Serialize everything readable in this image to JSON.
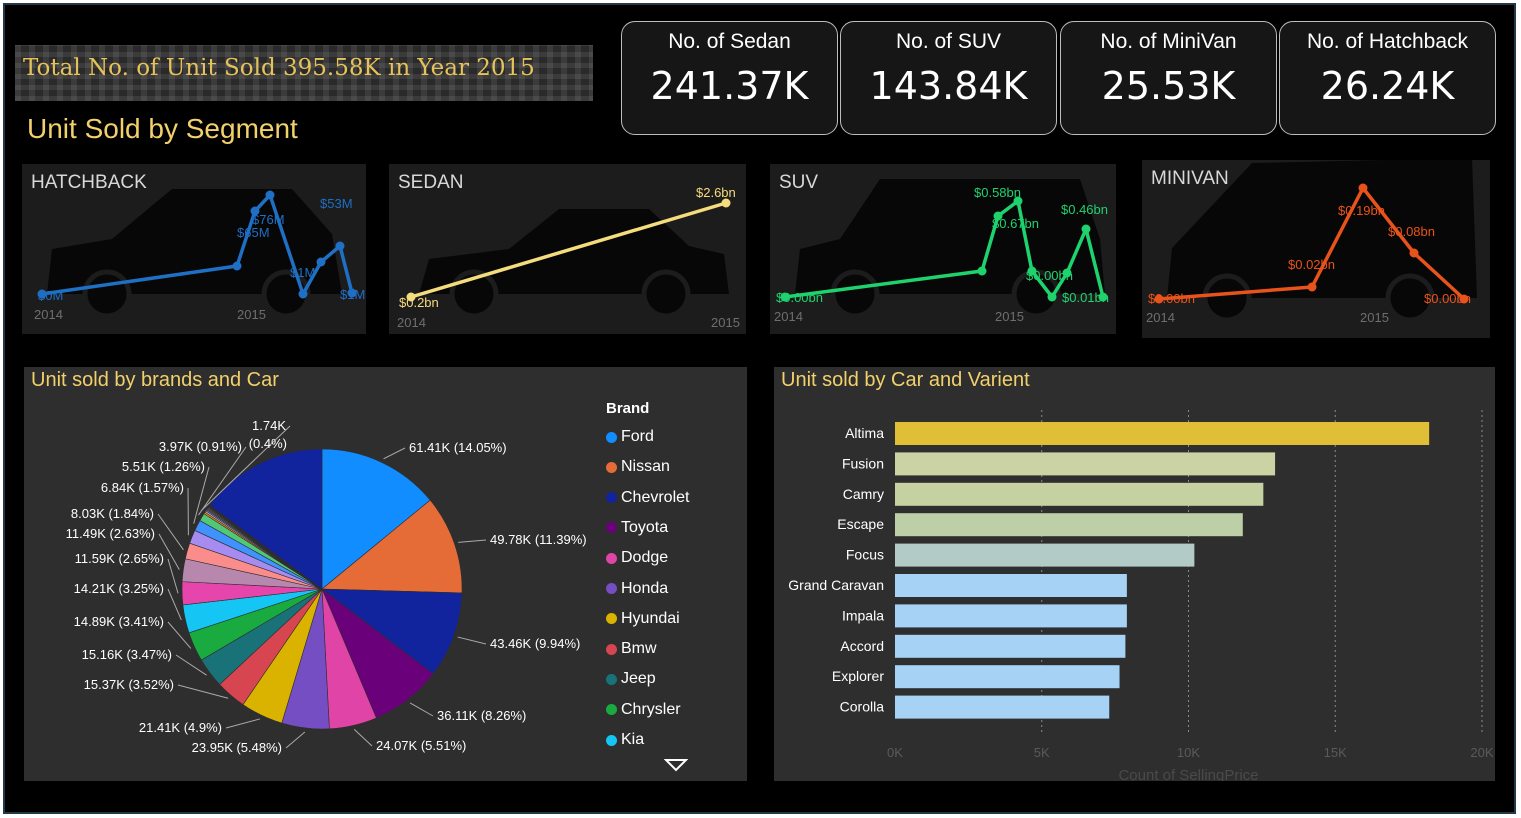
{
  "header": {
    "headline": "Total No. of Unit Sold 395.58K in Year 2015",
    "segment_title": "Unit Sold by Segment"
  },
  "kpis": [
    {
      "label": "No. of Sedan",
      "value": "241.37K"
    },
    {
      "label": "No. of SUV",
      "value": "143.84K"
    },
    {
      "label": "No. of MiniVan",
      "value": "25.53K"
    },
    {
      "label": "No. of Hatchback",
      "value": "26.24K"
    }
  ],
  "colors": {
    "hatchback": "#1f6fc4",
    "sedan": "#f5dc7d",
    "suv": "#1ed36e",
    "minivan": "#e8531c",
    "title": "#f2d16b"
  },
  "segments": [
    {
      "name": "HATCHBACK",
      "x_labels": [
        "2014",
        "2015"
      ],
      "labels": [
        "$0M",
        "$65M",
        "$76M",
        "$1M",
        "$53M",
        "$1M"
      ]
    },
    {
      "name": "SEDAN",
      "x_labels": [
        "2014",
        "2015"
      ],
      "labels": [
        "$0.2bn",
        "$2.6bn"
      ]
    },
    {
      "name": "SUV",
      "x_labels": [
        "2014",
        "2015"
      ],
      "labels": [
        "$0.00bn",
        "$0.58bn",
        "$0.67bn",
        "$0.00bn",
        "$0.46bn",
        "$0.01bn"
      ]
    },
    {
      "name": "MINIVAN",
      "x_labels": [
        "2014",
        "2015"
      ],
      "labels": [
        "$0.00bn",
        "$0.02bn",
        "$0.19bn",
        "$0.08bn",
        "$0.00bn"
      ]
    }
  ],
  "chart_data": [
    {
      "type": "pie",
      "title": "Unit sold by brands and Car",
      "legend_title": "Brand",
      "legend": [
        "Ford",
        "Nissan",
        "Chevrolet",
        "Toyota",
        "Dodge",
        "Honda",
        "Hyundai",
        "Bmw",
        "Jeep",
        "Chrysler",
        "Kia"
      ],
      "values": [
        61.41,
        49.78,
        43.46,
        36.11,
        24.07,
        23.95,
        21.41,
        15.37,
        15.16,
        14.89,
        14.21,
        11.59,
        11.49,
        8.03,
        6.84,
        5.51,
        3.97,
        1.74
      ],
      "labels": [
        "61.41K (14.05%)",
        "49.78K (11.39%)",
        "43.46K (9.94%)",
        "36.11K (8.26%)",
        "24.07K (5.51%)",
        "23.95K (5.48%)",
        "21.41K (4.9%)",
        "15.37K (3.52%)",
        "15.16K (3.47%)",
        "14.89K (3.41%)",
        "14.21K (3.25%)",
        "11.59K (2.65%)",
        "11.49K (2.63%)",
        "8.03K (1.84%)",
        "6.84K (1.57%)",
        "5.51K (1.26%)",
        "3.97K (0.91%)",
        "1.74K"
      ],
      "extra_label": "(0.4%)",
      "colors": [
        "#118dff",
        "#e66c37",
        "#12239e",
        "#6b007b",
        "#e044a7",
        "#744ec2",
        "#d9b300",
        "#d64550",
        "#197278",
        "#1aab40",
        "#15c6f4",
        "#e645ab",
        "#b887ad",
        "#fa8c8c",
        "#a68cf1",
        "#4092ff",
        "#50c878",
        "#ff7f0e",
        "#c0c0c0",
        "#7b68ee",
        "#2e8b57",
        "#ff6347",
        "#ba55d3",
        "#20b2aa",
        "#daa520"
      ],
      "small_slices": [
        0.9,
        0.8,
        0.7,
        0.6,
        0.5,
        0.4,
        0.35,
        0.3,
        0.3,
        0.25
      ]
    },
    {
      "type": "bar",
      "title": "Unit sold by Car and Varient",
      "categories": [
        "Altima",
        "Fusion",
        "Camry",
        "Escape",
        "Focus",
        "Grand Caravan",
        "Impala",
        "Accord",
        "Explorer",
        "Corolla"
      ],
      "values": [
        18200,
        12950,
        12550,
        11850,
        10200,
        7900,
        7900,
        7850,
        7650,
        7300
      ],
      "colors": [
        "#e0bf36",
        "#cbd2a4",
        "#c6d1a2",
        "#bccfa7",
        "#b3cbc6",
        "#a6d2f5",
        "#a6d2f5",
        "#a6d2f5",
        "#a6d2f5",
        "#a6d2f5"
      ],
      "xlabel": "Count of SellingPrice",
      "xlim": [
        0,
        20000
      ],
      "ticks": [
        "0K",
        "5K",
        "10K",
        "15K",
        "20K"
      ]
    }
  ]
}
